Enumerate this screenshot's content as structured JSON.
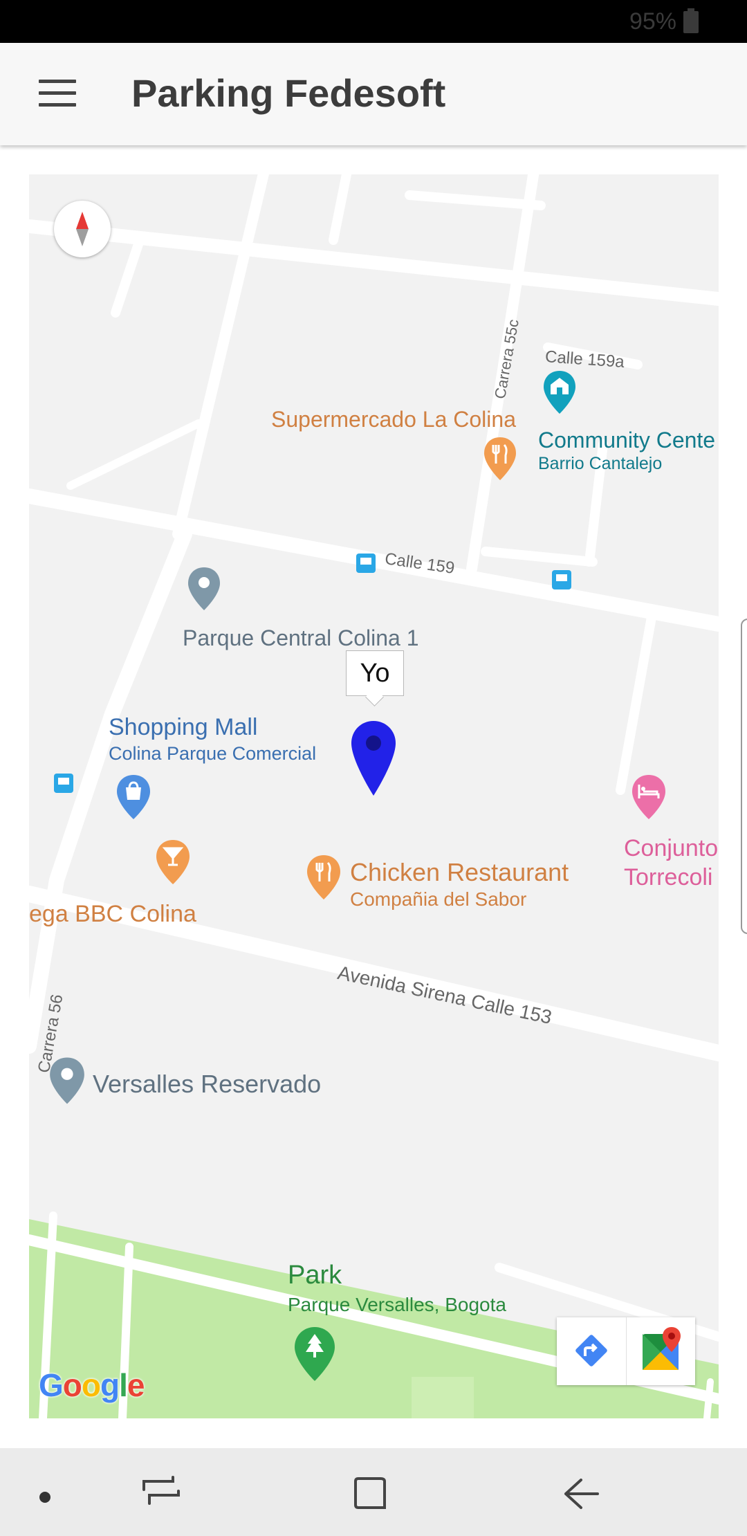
{
  "status_bar": {
    "battery": "95%"
  },
  "app_bar": {
    "title": "Parking Fedesoft",
    "menu_icon": "hamburger-menu-icon"
  },
  "map": {
    "user_marker": {
      "label": "Yo",
      "color": "#2222e8"
    },
    "places": {
      "supermarket": {
        "name": "Supermercado La Colina"
      },
      "community_center": {
        "name": "Community Cente",
        "sub": "Barrio Cantalejo"
      },
      "parque_central": {
        "name": "Parque Central Colina 1"
      },
      "shopping_mall": {
        "name": "Shopping Mall",
        "sub": "Colina Parque Comercial"
      },
      "bar": {
        "name": "ega BBC Colina"
      },
      "chicken_restaurant": {
        "name": "Chicken Restaurant",
        "sub": "Compañia del Sabor"
      },
      "hotel": {
        "name_line1": "Conjunto",
        "name_line2": "Torrecoli"
      },
      "versalles": {
        "name": "Versalles Reservado"
      },
      "park": {
        "name": "Park",
        "sub": "Parque Versalles, Bogota"
      }
    },
    "streets": {
      "calle_159a": "Calle 159a",
      "carrera_55c": "Carrera 55c",
      "calle_159": "Calle 159",
      "avenida_sirena": "Avenida Sirena Calle 153",
      "carrera_56": "Carrera 56"
    },
    "logo_text": "Google",
    "colors": {
      "food": "#f29c4f",
      "food_text": "#d08042",
      "community": "#12a1bd",
      "community_text": "#117a8b",
      "shopping": "#4e8fe0",
      "shopping_text": "#3a6fb0",
      "hotel": "#ec6fa8",
      "hotel_text": "#dd5f9a",
      "generic_pin": "#7f98a8",
      "generic_text": "#5f7180",
      "park": "#2fa84f",
      "park_text": "#2b8a3e",
      "transit": "#2aa7e6"
    }
  },
  "map_controls": {
    "directions_icon": "directions-icon",
    "maps_icon": "google-maps-icon"
  },
  "nav_bar": {
    "icons": [
      "dot-icon",
      "recent-apps-icon",
      "home-icon",
      "back-icon"
    ]
  }
}
